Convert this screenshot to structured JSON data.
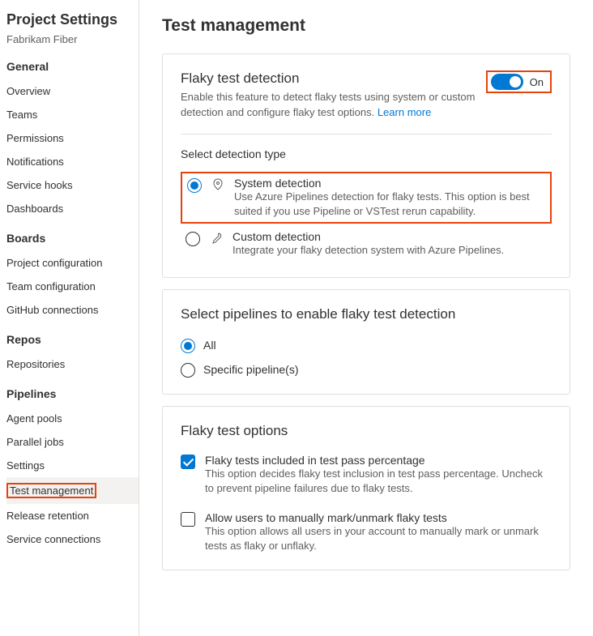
{
  "sidebar": {
    "title": "Project Settings",
    "subtitle": "Fabrikam Fiber",
    "sections": {
      "general": "General",
      "boards": "Boards",
      "repos": "Repos",
      "pipelines": "Pipelines"
    },
    "items": {
      "overview": "Overview",
      "teams": "Teams",
      "permissions": "Permissions",
      "notifications": "Notifications",
      "service_hooks": "Service hooks",
      "dashboards": "Dashboards",
      "project_config": "Project configuration",
      "team_config": "Team configuration",
      "github_conn": "GitHub connections",
      "repositories": "Repositories",
      "agent_pools": "Agent pools",
      "parallel_jobs": "Parallel jobs",
      "settings": "Settings",
      "test_management": "Test management",
      "release_retention": "Release retention",
      "service_connections": "Service connections"
    }
  },
  "main": {
    "title": "Test management",
    "flaky": {
      "title": "Flaky test detection",
      "desc": "Enable this feature to detect flaky tests using system or custom detection and configure flaky test options. ",
      "learn_more": "Learn more",
      "toggle_label": "On",
      "detection_heading": "Select detection type",
      "system_title": "System detection",
      "system_desc": "Use Azure Pipelines detection for flaky tests. This option is best suited if you use Pipeline or VSTest rerun capability.",
      "custom_title": "Custom detection",
      "custom_desc": "Integrate your flaky detection system with Azure Pipelines."
    },
    "pipelines": {
      "title": "Select pipelines to enable flaky test detection",
      "all": "All",
      "specific": "Specific pipeline(s)"
    },
    "options": {
      "title": "Flaky test options",
      "include_title": "Flaky tests included in test pass percentage",
      "include_desc": "This option decides flaky test inclusion in test pass percentage. Uncheck to prevent pipeline failures due to flaky tests.",
      "allow_title": "Allow users to manually mark/unmark flaky tests",
      "allow_desc": "This option allows all users in your account to manually mark or unmark tests as flaky or unflaky."
    }
  }
}
